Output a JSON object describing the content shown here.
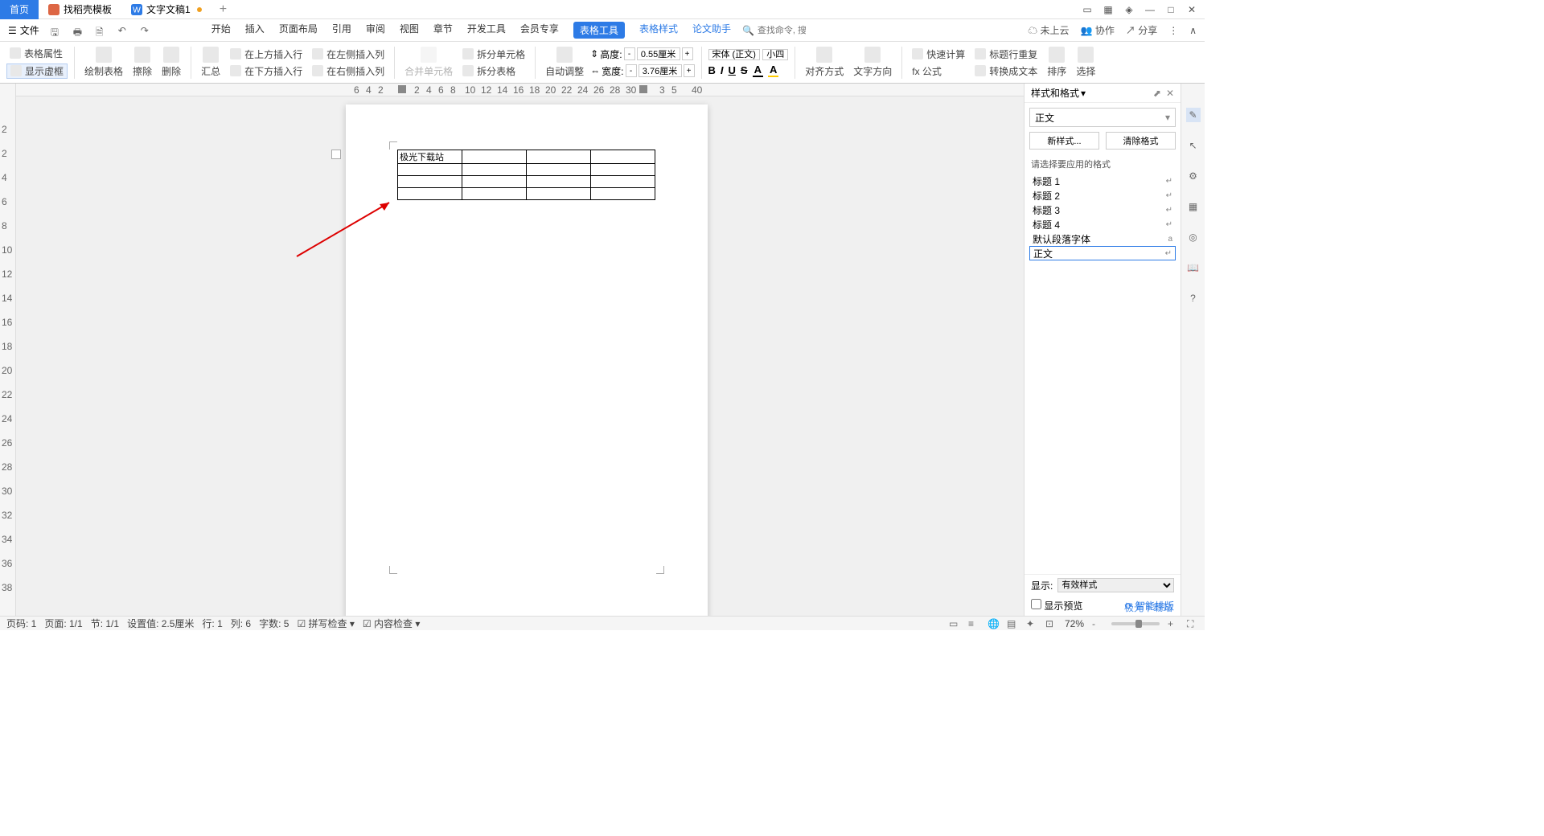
{
  "tabs": {
    "home": "首页",
    "template": "找稻壳模板",
    "doc": "文字文稿1"
  },
  "menubar": {
    "file": "文件",
    "search_placeholder": "查找命令, 搜索模板",
    "tabs": [
      "开始",
      "插入",
      "页面布局",
      "引用",
      "审阅",
      "视图",
      "章节",
      "开发工具",
      "会员专享"
    ],
    "active": "表格工具",
    "blue1": "表格样式",
    "blue2": "论文助手",
    "cloud": "未上云",
    "coop": "协作",
    "share": "分享"
  },
  "ribbon": {
    "table_prop": "表格属性",
    "show_frame": "显示虚框",
    "draw_table": "绘制表格",
    "erase": "擦除",
    "delete": "删除",
    "summary": "汇总",
    "ins_above": "在上方插入行",
    "ins_below": "在下方插入行",
    "ins_left": "在左侧插入列",
    "ins_right": "在右侧插入列",
    "merge": "合并单元格",
    "split_cell": "拆分单元格",
    "split_table": "拆分表格",
    "auto_adjust": "自动调整",
    "height": "高度:",
    "height_val": "0.55厘米",
    "width": "宽度:",
    "width_val": "3.76厘米",
    "font": "宋体 (正文)",
    "size": "小四",
    "align": "对齐方式",
    "text_dir": "文字方向",
    "formula": "fx 公式",
    "quick_calc": "快速计算",
    "header_repeat": "标题行重复",
    "to_text": "转换成文本",
    "sort": "排序",
    "select": "选择"
  },
  "document": {
    "cell_text": "极光下载站"
  },
  "side_panel": {
    "title": "样式和格式",
    "current": "正文",
    "new_style": "新样式...",
    "clear": "清除格式",
    "apply_label": "请选择要应用的格式",
    "styles": [
      {
        "name": "标题 1",
        "mark": "↵"
      },
      {
        "name": "标题 2",
        "mark": "↵"
      },
      {
        "name": "标题 3",
        "mark": "↵"
      },
      {
        "name": "标题 4",
        "mark": "↵"
      },
      {
        "name": "默认段落字体",
        "mark": "a"
      },
      {
        "name": "正文",
        "mark": "↵"
      }
    ],
    "show": "显示:",
    "show_val": "有效样式",
    "preview": "显示预览",
    "smart": "智能排版"
  },
  "statusbar": {
    "page_no": "页码: 1",
    "page": "页面: 1/1",
    "section": "节: 1/1",
    "setval": "设置值: 2.5厘米",
    "row": "行: 1",
    "col": "列: 6",
    "chars": "字数: 5",
    "spell": "拼写检查",
    "content": "内容检查",
    "zoom": "72%"
  },
  "watermark": "极光下载站"
}
